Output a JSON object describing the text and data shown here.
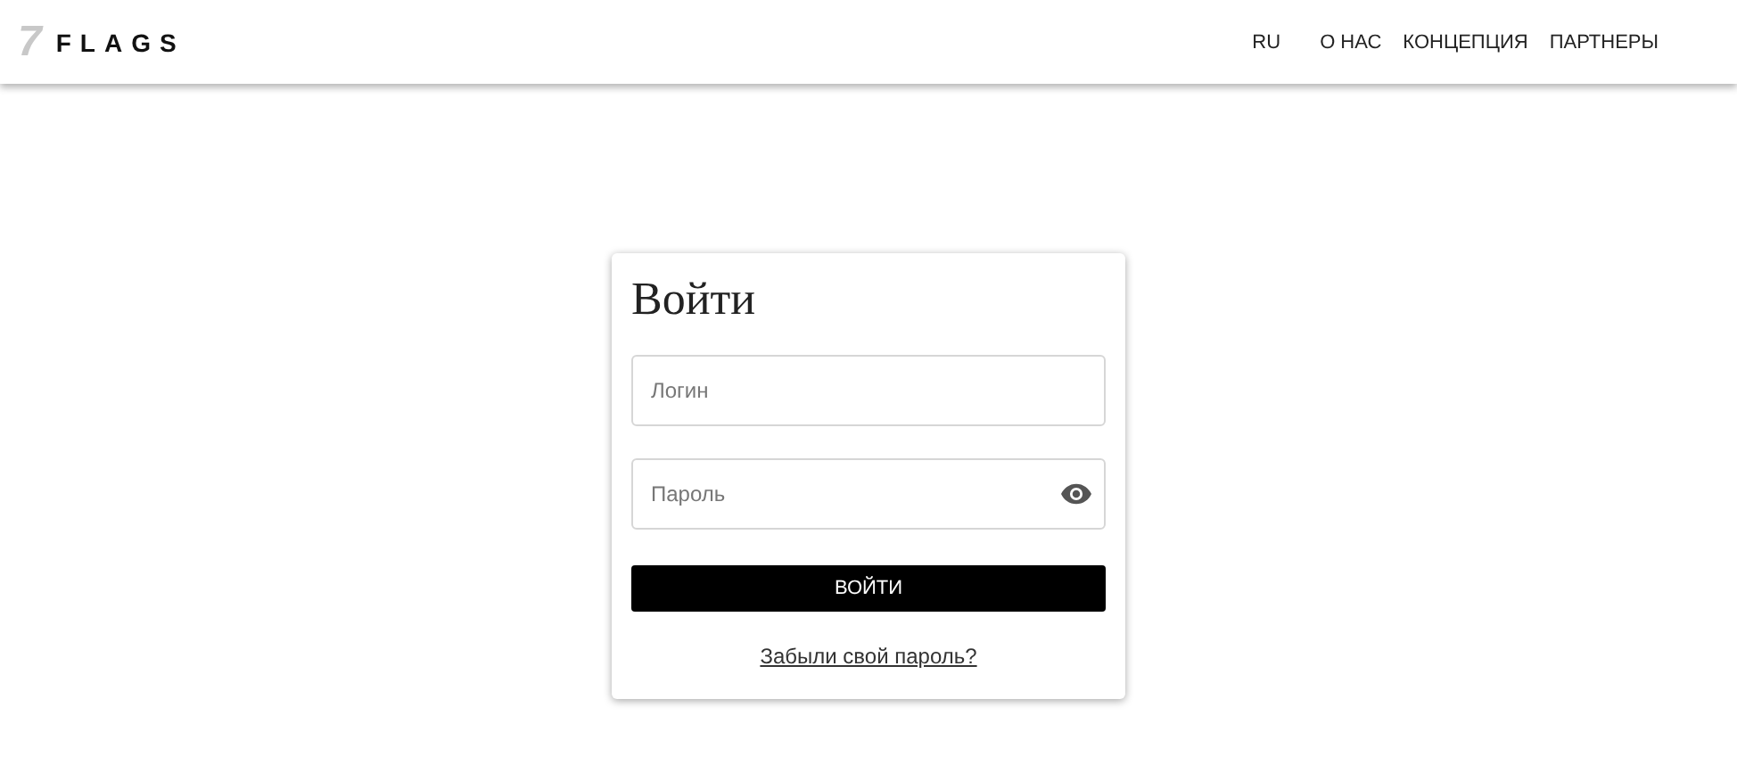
{
  "header": {
    "logo_mark": "7",
    "logo_text": "FLAGS",
    "nav": [
      {
        "label": "RU"
      },
      {
        "label": "О НАС"
      },
      {
        "label": "КОНЦЕПЦИЯ"
      },
      {
        "label": "ПАРТНЕРЫ"
      }
    ]
  },
  "login": {
    "title": "Войти",
    "fields": [
      {
        "kind": "text",
        "placeholder": "Логин"
      },
      {
        "kind": "password",
        "placeholder": "Пароль"
      }
    ],
    "submit": "ВОЙТИ",
    "forgot": "Забыли свой пароль?"
  }
}
